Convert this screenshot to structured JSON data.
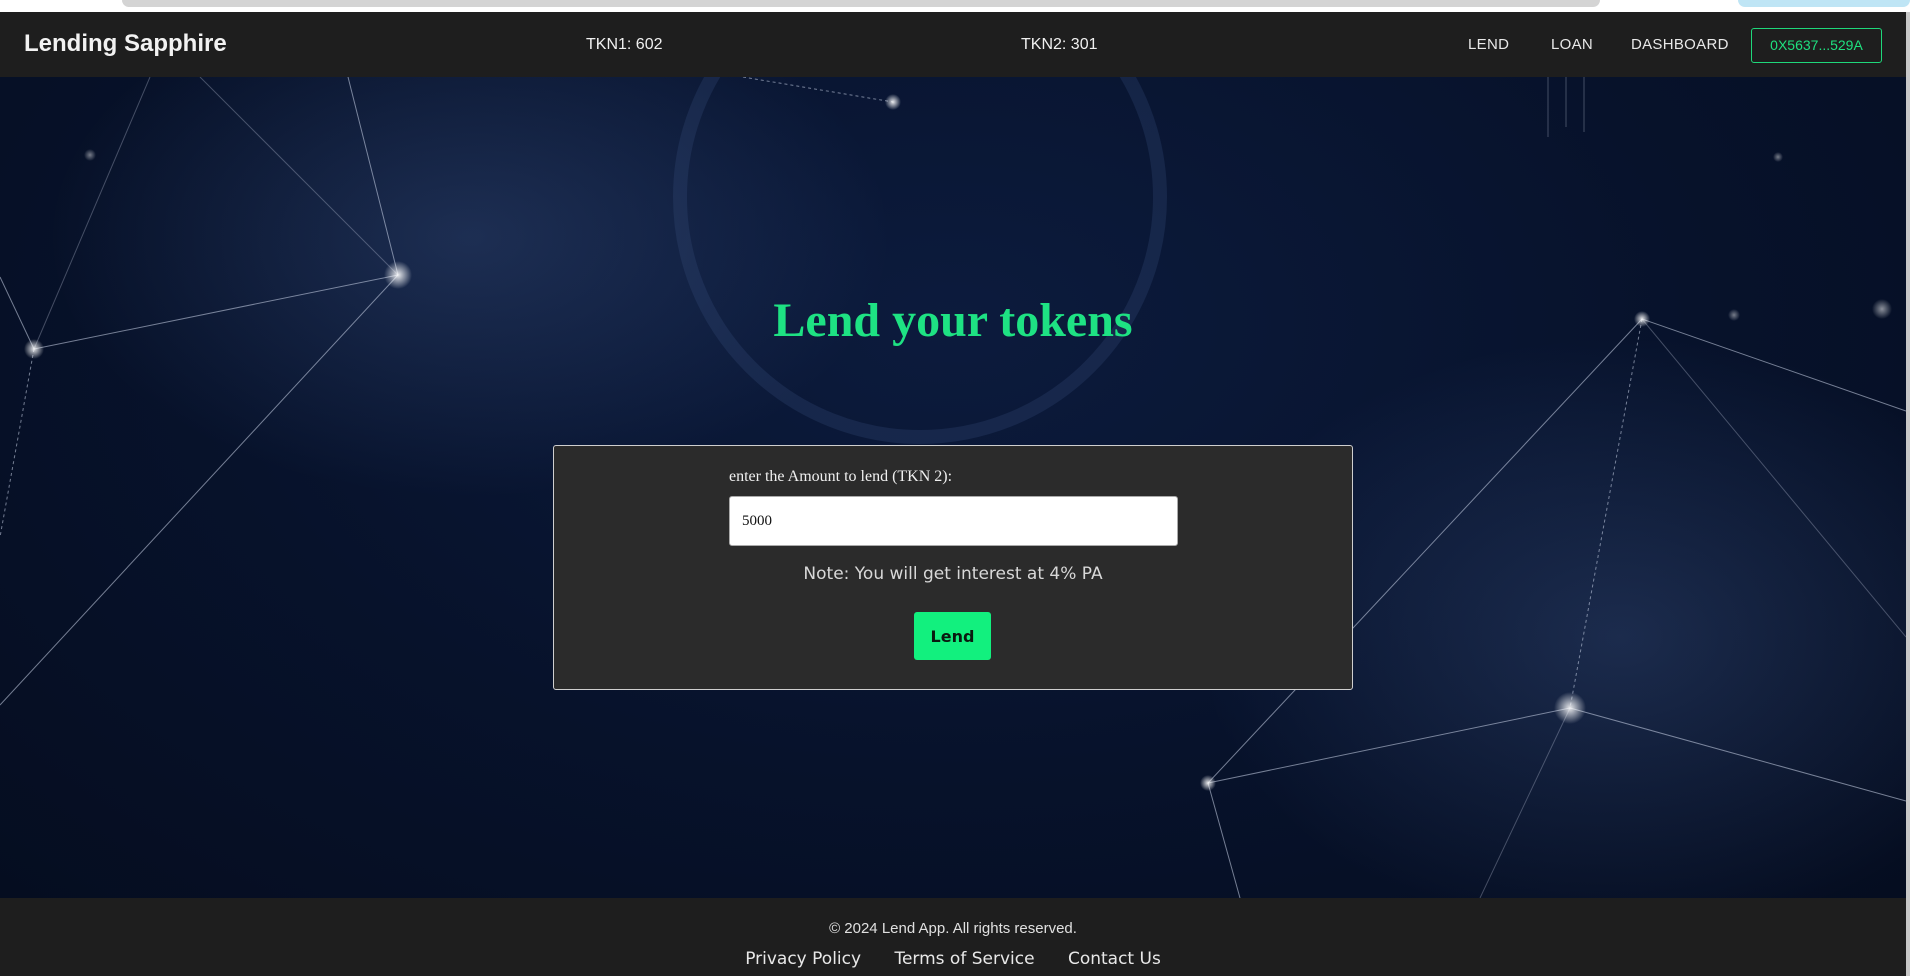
{
  "navbar": {
    "brand": "Lending Sapphire",
    "tkn1_balance": "TKN1: 602",
    "tkn2_balance": "TKN2: 301",
    "links": {
      "lend": "LEND",
      "loan": "LOAN",
      "dashboard": "DASHBOARD"
    },
    "wallet": "0X5637...529A"
  },
  "main": {
    "title": "Lend your tokens",
    "form": {
      "label": "enter the Amount to lend (TKN 2):",
      "amount_value": "5000",
      "note": "Note: You will get interest at 4% PA",
      "submit_label": "Lend"
    }
  },
  "footer": {
    "copyright": "© 2024 Lend App. All rights reserved.",
    "links": {
      "privacy": "Privacy Policy",
      "terms": "Terms of Service",
      "contact": "Contact Us"
    }
  },
  "colors": {
    "accent": "#1ee283",
    "button": "#12f07e",
    "navbar": "#1e1e1e",
    "card": "#2b2b2b"
  }
}
